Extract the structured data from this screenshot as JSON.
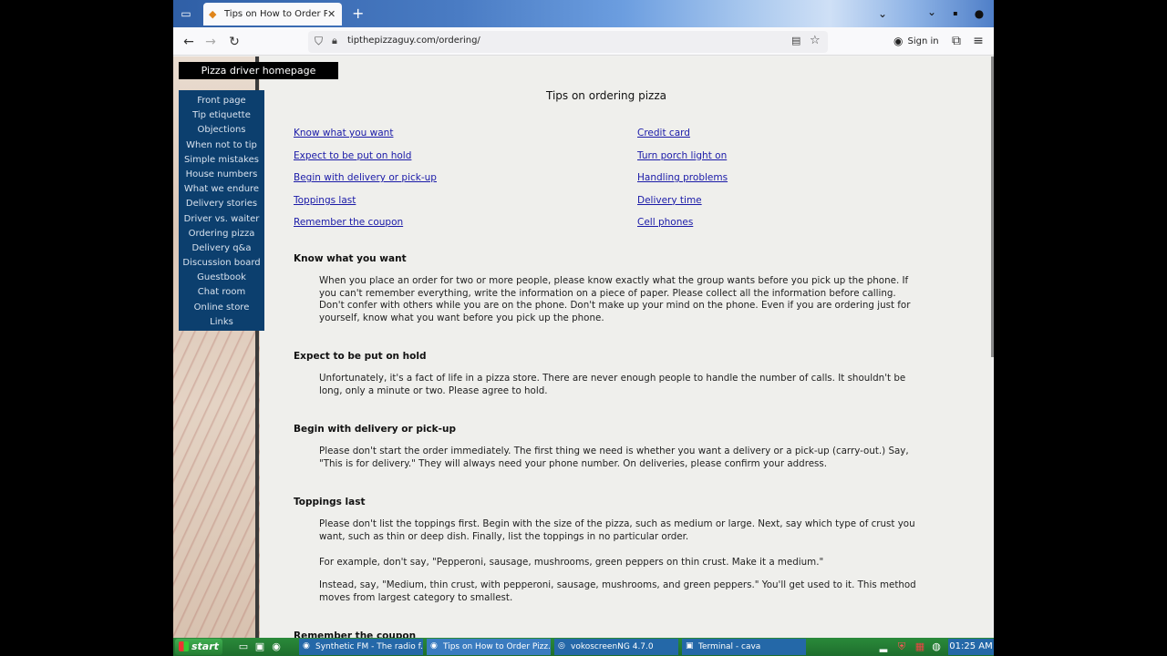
{
  "browser": {
    "tab_title": "Tips on How to Order Pizza",
    "url": "tipthepizzaguy.com/ordering/",
    "sign_in": "Sign in"
  },
  "site": {
    "home_link": "Pizza driver homepage",
    "nav": [
      "Front page",
      "Tip etiquette",
      "Objections",
      "When not to tip",
      "Simple mistakes",
      "House numbers",
      "What we endure",
      "Delivery stories",
      "Driver vs. waiter",
      "Ordering pizza",
      "Delivery q&a",
      "Discussion board",
      "Guestbook",
      "Chat room",
      "Online store",
      "Links"
    ]
  },
  "content": {
    "title": "Tips on ordering pizza",
    "toc_left": [
      "Know what you want",
      "Expect to be put on hold",
      "Begin with delivery or pick-up",
      "Toppings last",
      "Remember the coupon"
    ],
    "toc_right": [
      "Credit card",
      "Turn porch light on",
      "Handling problems",
      "Delivery time",
      "Cell phones"
    ],
    "sections": [
      {
        "heading": "Know what you want",
        "paragraphs": [
          "When you place an order for two or more people, please know exactly what the group wants before you pick up the phone. If you can't remember everything, write the information on a piece of paper. Please collect all the information before calling. Don't confer with others while you are on the phone. Don't make up your mind on the phone. Even if you are ordering just for yourself, know what you want before you pick up the phone."
        ]
      },
      {
        "heading": "Expect to be put on hold",
        "paragraphs": [
          "Unfortunately, it's a fact of life in a pizza store. There are never enough people to handle the number of calls. It shouldn't be long, only a minute or two. Please agree to hold."
        ]
      },
      {
        "heading": "Begin with delivery or pick-up",
        "paragraphs": [
          "Please don't start the order immediately. The first thing we need is whether you want a delivery or a pick-up (carry-out.) Say, \"This is for delivery.\" They will always need your phone number. On deliveries, please confirm your address."
        ]
      },
      {
        "heading": "Toppings last",
        "paragraphs": [
          "Please don't list the toppings first. Begin with the size of the pizza, such as medium or large. Next, say which type of crust you want, such as thin or deep dish. Finally, list the toppings in no particular order.",
          "For example, don't say, \"Pepperoni, sausage, mushrooms, green peppers on thin crust. Make it a medium.\"",
          "Instead, say, \"Medium, thin crust, with pepperoni, sausage, mushrooms, and green peppers.\" You'll get used to it. This method moves from largest category to smallest."
        ]
      },
      {
        "heading": "Remember the coupon",
        "paragraphs": []
      }
    ]
  },
  "taskbar": {
    "start": "start",
    "tasks": [
      "Synthetic FM - The radio f...",
      "Tips on How to Order Pizz...",
      "vokoscreenNG 4.7.0",
      "Terminal - cava"
    ],
    "clock": "01:25 AM"
  }
}
